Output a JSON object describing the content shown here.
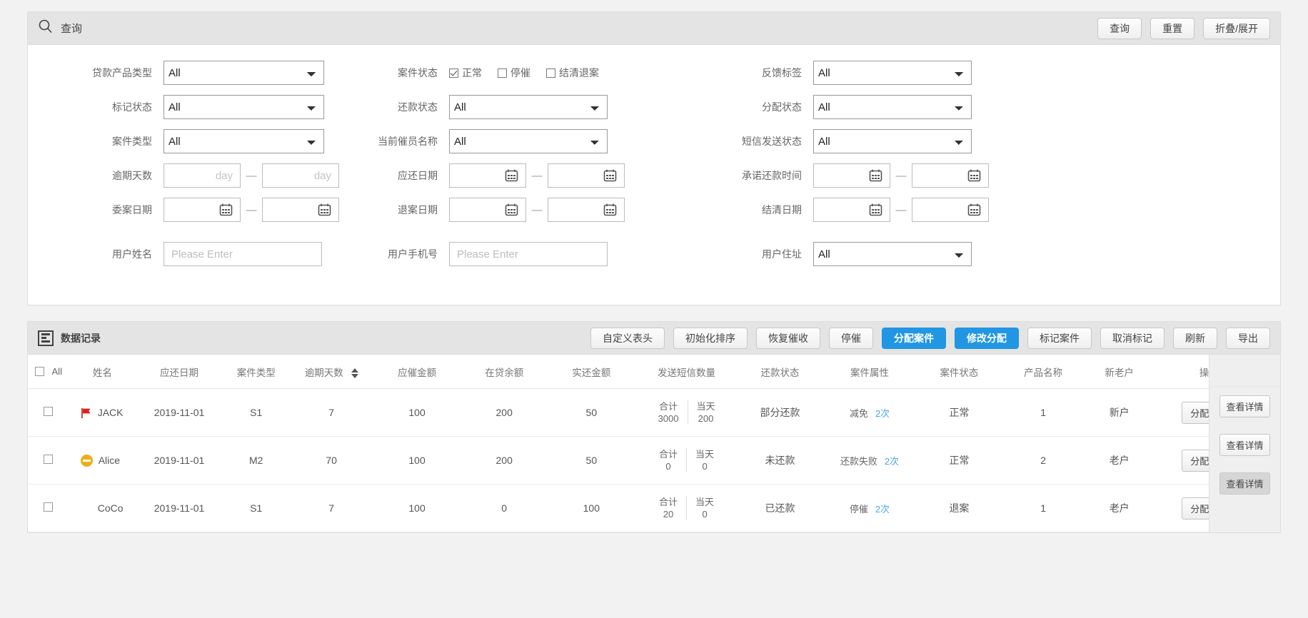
{
  "search": {
    "title": "查询",
    "icon": "search-icon",
    "buttons": {
      "query": "查询",
      "reset": "重置",
      "toggle": "折叠/展开"
    },
    "labels": {
      "loan_product_type": "贷款产品类型",
      "case_status": "案件状态",
      "feedback_tag": "反馈标签",
      "mark_status": "标记状态",
      "repay_status": "还款状态",
      "assign_status": "分配状态",
      "case_type": "案件类型",
      "current_collector": "当前催员名称",
      "sms_send_status": "短信发送状态",
      "overdue_days": "逾期天数",
      "due_date": "应还日期",
      "promise_repay_time": "承诺还款时间",
      "entrust_date": "委案日期",
      "return_date": "退案日期",
      "settle_date": "结清日期",
      "user_name": "用户姓名",
      "user_phone": "用户手机号",
      "user_address": "用户住址"
    },
    "values": {
      "loan_product_type": "All",
      "feedback_tag": "All",
      "mark_status": "All",
      "repay_status": "All",
      "assign_status": "All",
      "case_type": "All",
      "current_collector": "All",
      "sms_send_status": "All",
      "user_address": "All"
    },
    "case_status_options": [
      {
        "label": "正常",
        "checked": true
      },
      {
        "label": "停催",
        "checked": false
      },
      {
        "label": "结清退案",
        "checked": false
      }
    ],
    "placeholders": {
      "day": "day",
      "please_enter": "Please Enter"
    },
    "range_dash": "—"
  },
  "data_panel": {
    "title": "数据记录",
    "icon": "list-icon",
    "buttons": [
      {
        "label": "自定义表头",
        "style": "default"
      },
      {
        "label": "初始化排序",
        "style": "default"
      },
      {
        "label": "恢复催收",
        "style": "default"
      },
      {
        "label": "停催",
        "style": "default"
      },
      {
        "label": "分配案件",
        "style": "primary"
      },
      {
        "label": "修改分配",
        "style": "primary"
      },
      {
        "label": "标记案件",
        "style": "default"
      },
      {
        "label": "取消标记",
        "style": "default"
      },
      {
        "label": "刷新",
        "style": "default"
      },
      {
        "label": "导出",
        "style": "default"
      }
    ],
    "accent_color": "#2196e3",
    "table": {
      "select_all_label": "All",
      "columns": [
        "姓名",
        "应还日期",
        "案件类型",
        "逾期天数",
        "应催金额",
        "在贷余额",
        "实还金额",
        "发送短信数量",
        "还款状态",
        "案件属性",
        "案件状态",
        "产品名称",
        "新老户",
        "操作"
      ],
      "sms_sub": {
        "total": "合计",
        "today": "当天"
      },
      "detail_label": "查看详情",
      "assign_record_label": "分配记录",
      "rows": [
        {
          "checked": false,
          "status_icon": "flag-icon",
          "name": "JACK",
          "due_date": "2019-11-01",
          "case_type": "S1",
          "overdue_days": "7",
          "due_amount": "100",
          "balance": "200",
          "real_amount": "50",
          "sms_total": "3000",
          "sms_today": "200",
          "repay_status": "部分还款",
          "attr": "减免",
          "attr_times": "2次",
          "case_status": "正常",
          "product": "1",
          "new_old": "新户",
          "op": "分配记录",
          "detail": "查看详情",
          "detail_hover": false
        },
        {
          "checked": false,
          "status_icon": "pause-icon",
          "name": "Alice",
          "due_date": "2019-11-01",
          "case_type": "M2",
          "overdue_days": "70",
          "due_amount": "100",
          "balance": "200",
          "real_amount": "50",
          "sms_total": "0",
          "sms_today": "0",
          "repay_status": "未还款",
          "attr": "还款失败",
          "attr_times": "2次",
          "case_status": "正常",
          "product": "2",
          "new_old": "老户",
          "op": "分配记录",
          "detail": "查看详情",
          "detail_hover": false
        },
        {
          "checked": false,
          "status_icon": "",
          "name": "CoCo",
          "due_date": "2019-11-01",
          "case_type": "S1",
          "overdue_days": "7",
          "due_amount": "100",
          "balance": "0",
          "real_amount": "100",
          "sms_total": "20",
          "sms_today": "0",
          "repay_status": "已还款",
          "attr": "停催",
          "attr_times": "2次",
          "case_status": "退案",
          "product": "1",
          "new_old": "老户",
          "op": "分配记录",
          "detail": "查看详情",
          "detail_hover": true
        }
      ]
    }
  }
}
